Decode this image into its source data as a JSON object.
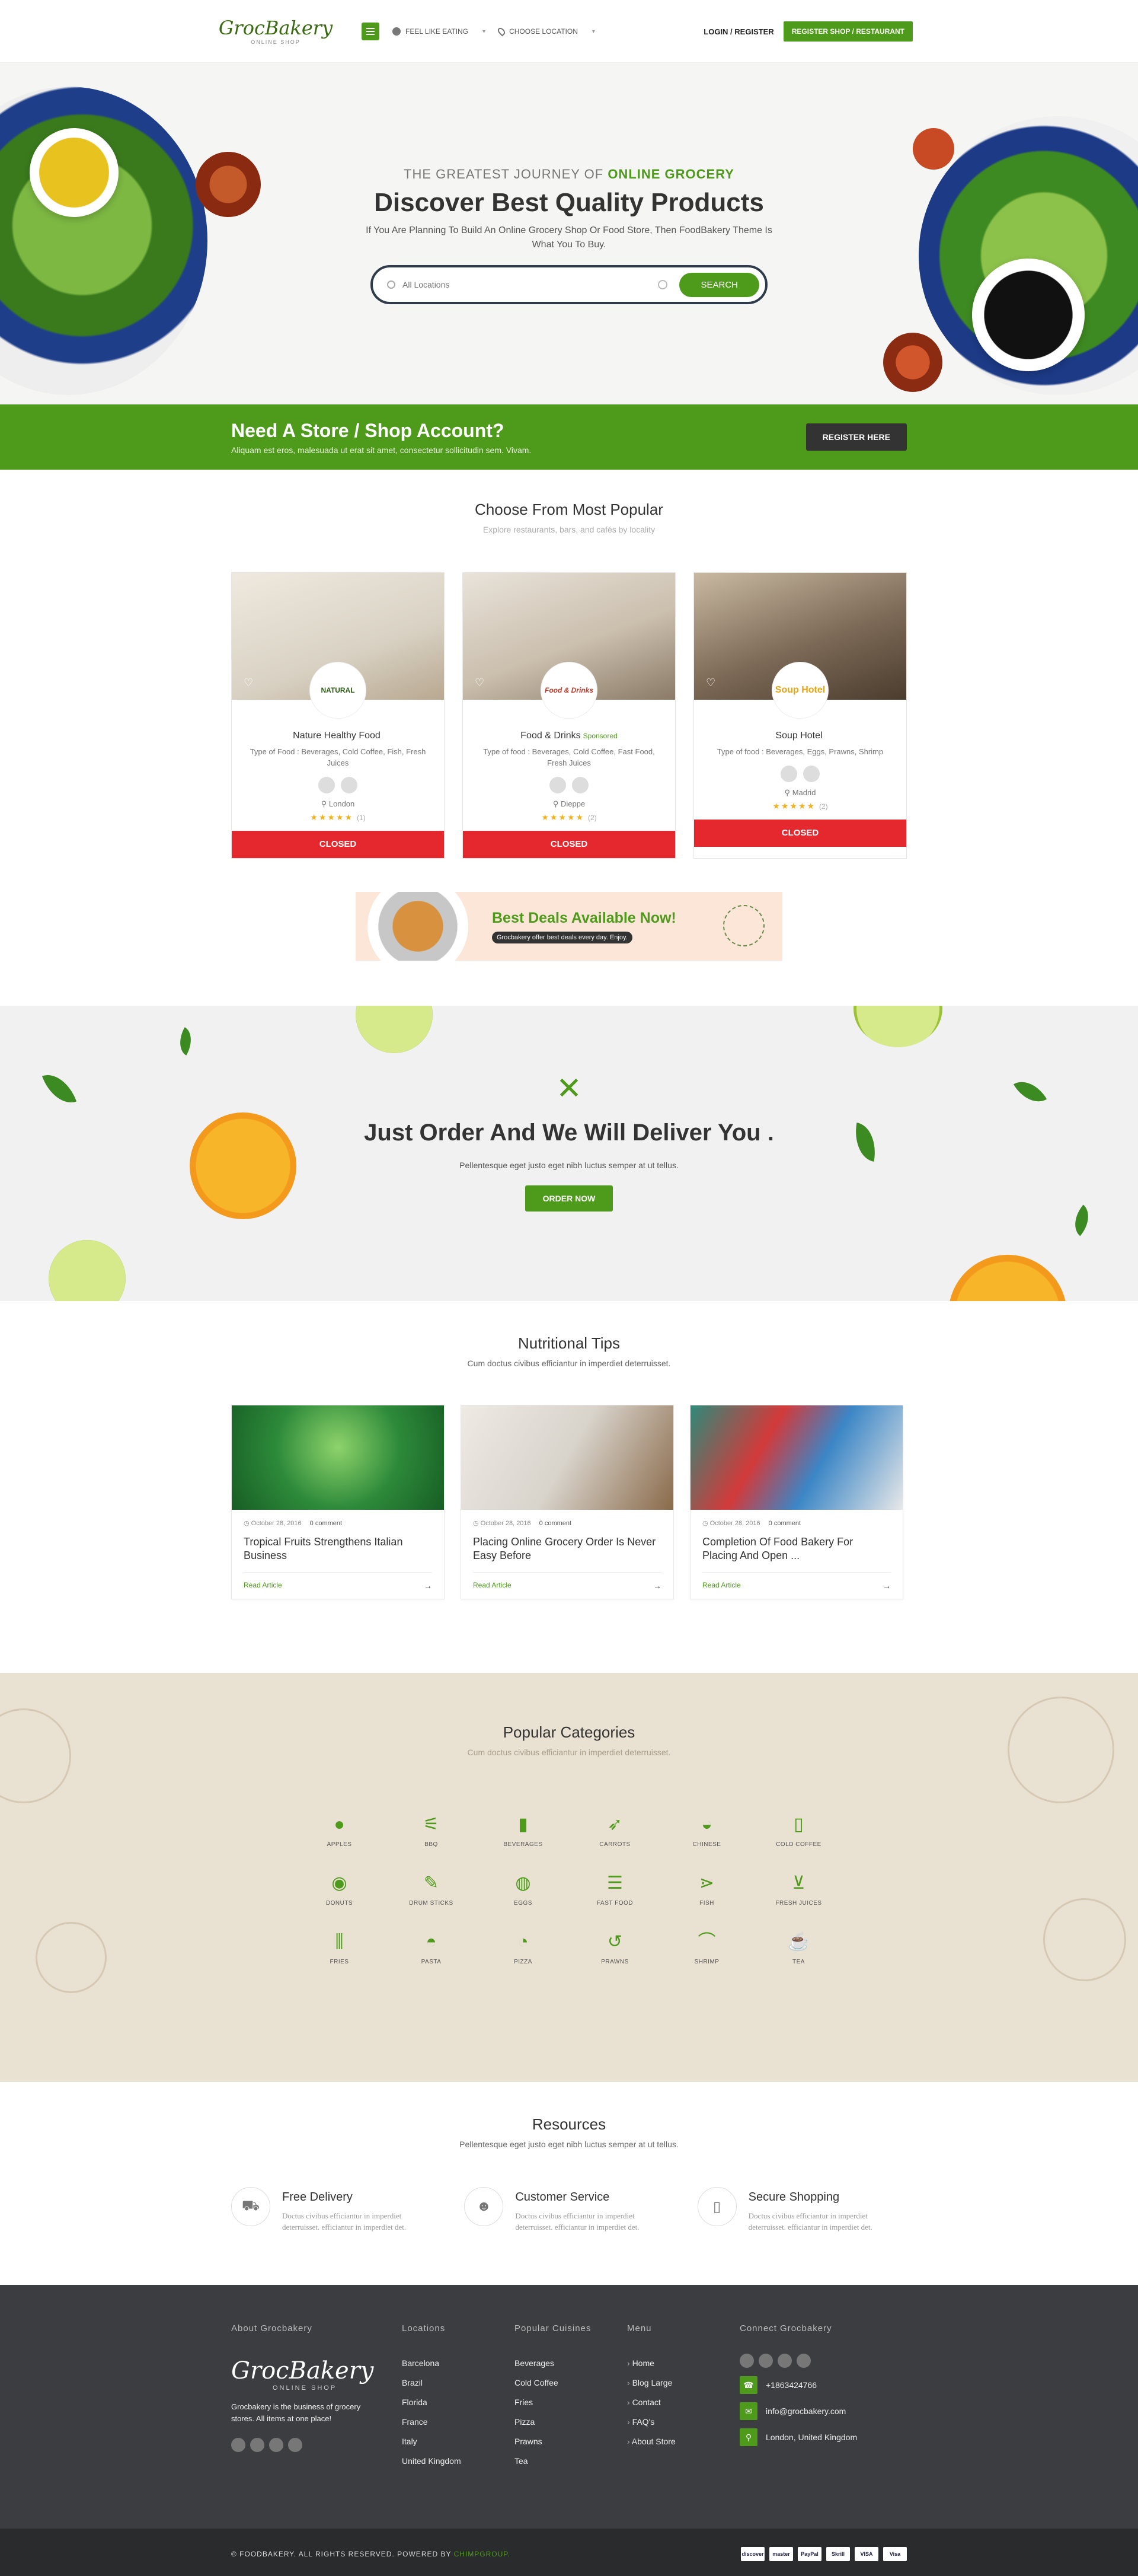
{
  "header": {
    "logo": "GrocBakery",
    "logo_sub": "ONLINE SHOP",
    "feel_like": "FEEL LIKE EATING",
    "choose_location": "CHOOSE LOCATION",
    "login": "LOGIN / REGISTER",
    "register_btn": "REGISTER SHOP / RESTAURANT"
  },
  "hero": {
    "subtitle_pre": "THE GREATEST JOURNEY OF",
    "subtitle_accent": "ONLINE GROCERY",
    "title": "Discover Best Quality Products",
    "text": "If You Are Planning To Build An Online Grocery Shop Or Food Store, Then FoodBakery Theme Is What You To Buy.",
    "search_placeholder": "All Locations",
    "search_btn": "SEARCH"
  },
  "banner": {
    "title": "Need A Store / Shop Account?",
    "text": "Aliquam est eros, malesuada ut erat sit amet, consectetur sollicitudin sem. Vivam.",
    "button": "REGISTER HERE"
  },
  "popular": {
    "title": "Choose From Most Popular",
    "subtitle": "Explore restaurants, bars, and cafés by locality",
    "cards": [
      {
        "name": "Nature Healthy Food",
        "sponsored": "",
        "logo": "NATURAL",
        "types": "Type of Food : Beverages, Cold Coffee, Fish, Fresh Juices",
        "city": "London",
        "stars": "★★★★★",
        "count": "(1)",
        "status": "CLOSED",
        "img_color": "#d9d2c4"
      },
      {
        "name": "Food & Drinks",
        "sponsored": "Sponsored",
        "logo": "Food & Drinks",
        "types": "Type of food : Beverages, Cold Coffee, Fast Food, Fresh Juices",
        "city": "Dieppe",
        "stars": "★★★★★",
        "count": "(2)",
        "status": "CLOSED",
        "img_color": "#cbbfae"
      },
      {
        "name": "Soup Hotel",
        "sponsored": "",
        "logo": "Soup Hotel",
        "types": "Type of food : Beverages, Eggs, Prawns, Shrimp",
        "city": "Madrid",
        "stars": "★★★★★",
        "count": "(2)",
        "status": "CLOSED",
        "img_color": "#7d6a57"
      }
    ],
    "deal_title": "Best Deals Available Now!",
    "deal_text": "Grocbakery offer best deals every day. Enjoy."
  },
  "deliver": {
    "title": "Just Order And We Will Deliver You .",
    "text": "Pellentesque eget justo eget nibh luctus semper at ut tellus.",
    "button": "ORDER NOW"
  },
  "tips": {
    "title": "Nutritional Tips",
    "subtitle": "Cum doctus civibus efficiantur in imperdiet deterruisset.",
    "items": [
      {
        "date": "October 28, 2016",
        "comments": "0 comment",
        "title": "Tropical Fruits Strengthens Italian Business",
        "link": "Read Article",
        "img_color": "#2d8a3a"
      },
      {
        "date": "October 28, 2016",
        "comments": "0 comment",
        "title": "Placing Online Grocery Order Is Never Easy Before",
        "link": "Read Article",
        "img_color": "#d8d3cb"
      },
      {
        "date": "October 28, 2016",
        "comments": "0 comment",
        "title": "Completion Of Food Bakery For Placing And Open ...",
        "link": "Read Article",
        "img_color": "#3b86c6"
      }
    ]
  },
  "categories": {
    "title": "Popular Categories",
    "subtitle": "Cum doctus civibus efficiantur in imperdiet deterruisset.",
    "items": [
      {
        "label": "APPLES",
        "icon": "●"
      },
      {
        "label": "BBQ",
        "icon": "⚟"
      },
      {
        "label": "BEVERAGES",
        "icon": "▮"
      },
      {
        "label": "CARROTS",
        "icon": "➶"
      },
      {
        "label": "CHINESE",
        "icon": "◒"
      },
      {
        "label": "COLD COFFEE",
        "icon": "▯"
      },
      {
        "label": "DONUTS",
        "icon": "◉"
      },
      {
        "label": "DRUM STICKS",
        "icon": "✎"
      },
      {
        "label": "EGGS",
        "icon": "◍"
      },
      {
        "label": "FAST FOOD",
        "icon": "☰"
      },
      {
        "label": "FISH",
        "icon": "⋗"
      },
      {
        "label": "FRESH JUICES",
        "icon": "⊻"
      },
      {
        "label": "FRIES",
        "icon": "⫼"
      },
      {
        "label": "PASTA",
        "icon": "◓"
      },
      {
        "label": "PIZZA",
        "icon": "◔"
      },
      {
        "label": "PRAWNS",
        "icon": "↺"
      },
      {
        "label": "SHRIMP",
        "icon": "⌒"
      },
      {
        "label": "TEA",
        "icon": "☕"
      }
    ]
  },
  "resources": {
    "title": "Resources",
    "subtitle": "Pellentesque eget justo eget nibh luctus semper at ut tellus.",
    "items": [
      {
        "title": "Free Delivery",
        "text": "Doctus civibus efficiantur in imperdiet deterruisset. efficiantur in imperdiet det.",
        "icon": "truck-icon"
      },
      {
        "title": "Customer Service",
        "text": "Doctus civibus efficiantur in imperdiet deterruisset. efficiantur in imperdiet det.",
        "icon": "user-icon"
      },
      {
        "title": "Secure Shopping",
        "text": "Doctus civibus efficiantur in imperdiet deterruisset. efficiantur in imperdiet det.",
        "icon": "phone-icon"
      }
    ]
  },
  "footer": {
    "about_title": "About Grocbakery",
    "about_text": "Grocbakery is the business of grocery stores. All items at one place!",
    "locations_title": "Locations",
    "locations": [
      "Barcelona",
      "Brazil",
      "Florida",
      "France",
      "Italy",
      "United Kingdom"
    ],
    "cuisines_title": "Popular Cuisines",
    "cuisines": [
      "Beverages",
      "Cold Coffee",
      "Fries",
      "Pizza",
      "Prawns",
      "Tea"
    ],
    "menu_title": "Menu",
    "menu": [
      "Home",
      "Blog Large",
      "Contact",
      "FAQ's",
      "About Store"
    ],
    "connect_title": "Connect Grocbakery",
    "phone": "+1863424766",
    "email": "info@grocbakery.com",
    "address": "London, United Kingdom",
    "copyright": "© FOODBAKERY. ALL RIGHTS RESERVED. POWERED BY",
    "powered": "CHIMPGROUP.",
    "payments": [
      "discover",
      "master",
      "PayPal",
      "Skrill",
      "VISA",
      "Visa"
    ]
  }
}
